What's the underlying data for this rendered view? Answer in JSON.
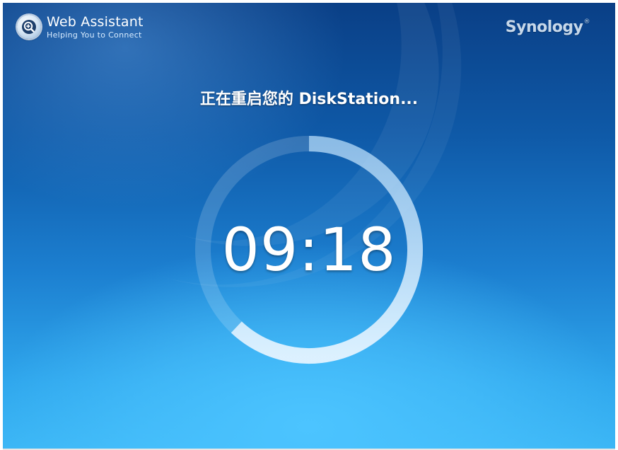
{
  "header": {
    "app_title": "Web Assistant",
    "app_subtitle": "Helping You to Connect",
    "brand": "Synology",
    "brand_mark": "®",
    "logo_icon": "magnifier-plus-icon"
  },
  "main": {
    "status_message": "正在重启您的 DiskStation...",
    "countdown": "09:18",
    "progress_fraction": 0.62
  },
  "colors": {
    "background_top": "#0a3f86",
    "background_bottom": "#3bb6f5",
    "text": "#ffffff",
    "ring_track": "rgba(255,255,255,0.18)",
    "ring_progress": "#cfe9ff"
  }
}
